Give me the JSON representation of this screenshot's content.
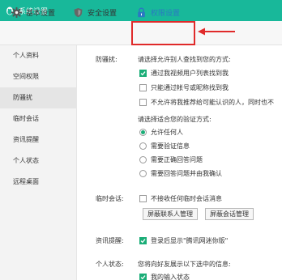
{
  "window": {
    "title": "系统设置"
  },
  "tabs": {
    "basic": "基本设置",
    "security": "安全设置",
    "permission": "权限设置"
  },
  "sidebar": {
    "items": [
      {
        "label": "个人资料"
      },
      {
        "label": "空间权限"
      },
      {
        "label": "防骚扰"
      },
      {
        "label": "临时会话"
      },
      {
        "label": "资讯提醒"
      },
      {
        "label": "个人状态"
      },
      {
        "label": "远程桌面"
      }
    ],
    "active": "防骚扰"
  },
  "anti_harass": {
    "label": "防骚扰:",
    "find_heading": "请选择允许别人查找到您的方式:",
    "find_options": [
      {
        "label": "通过我视频用户列表找到我",
        "checked": true
      },
      {
        "label": "只能通过帐号或昵称找到我",
        "checked": false
      },
      {
        "label": "不允许将我推荐给可能认识的人，同时也不",
        "checked": false
      }
    ],
    "verify_heading": "请选择适合您的验证方式:",
    "verify_options": [
      {
        "label": "允许任何人",
        "selected": true
      },
      {
        "label": "需要验证信息",
        "selected": false
      },
      {
        "label": "需要正确回答问题",
        "selected": false
      },
      {
        "label": "需要回答问题并由我确认",
        "selected": false
      }
    ]
  },
  "temp_session": {
    "label": "临时会话:",
    "option": {
      "label": "不接收任何临时会话消息",
      "checked": false
    },
    "block_contacts_button": "屏蔽联系人管理",
    "block_session_button": "屏蔽会话管理"
  },
  "news": {
    "label": "资讯提醒:",
    "option": {
      "label": "登录后显示\"腾讯网迷你版\"",
      "checked": true
    }
  },
  "status": {
    "label": "个人状态:",
    "heading": "您将向好友展示以下选中的信息:",
    "option": {
      "label": "我的输入状态",
      "checked": true
    }
  },
  "colors": {
    "titlebar": "#18b89a",
    "accent_green": "#1aad77",
    "highlight_red": "#e02a2a",
    "link_blue": "#2b78c2"
  },
  "icons": {
    "app": "qq-penguin-icon",
    "basic": "gear-icon",
    "security": "shield-icon",
    "permission": "lock-icon"
  }
}
